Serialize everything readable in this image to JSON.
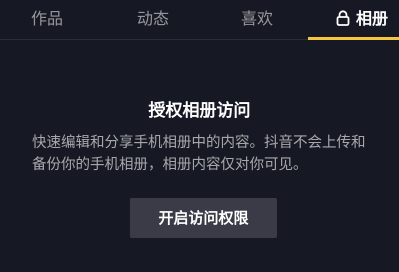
{
  "tabs": [
    {
      "label": "作品"
    },
    {
      "label": "动态"
    },
    {
      "label": "喜欢"
    },
    {
      "label": "相册",
      "icon": "lock-icon",
      "active": true
    }
  ],
  "accent_color": "#f5c542",
  "prompt": {
    "title": "授权相册访问",
    "description": "快速编辑和分享手机相册中的内容。抖音不会上传和备份你的手机相册，相册内容仅对你可见。",
    "button_label": "开启访问权限"
  }
}
